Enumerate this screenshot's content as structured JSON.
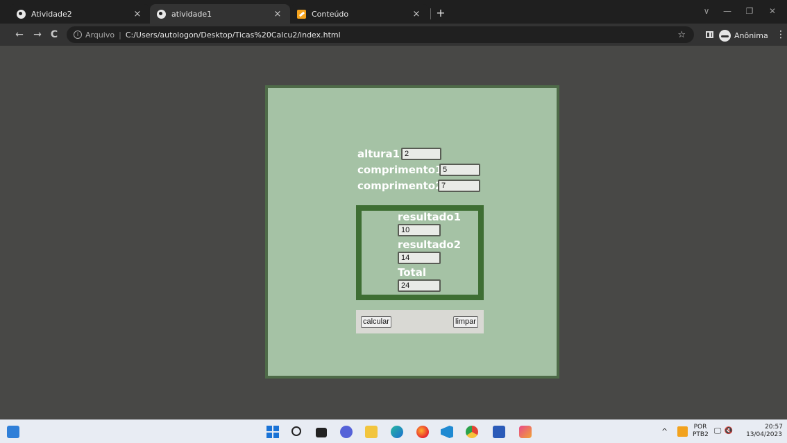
{
  "browser": {
    "tabs": [
      {
        "title": "Atividade2",
        "close": "×"
      },
      {
        "title": "atividade1",
        "close": "×"
      },
      {
        "title": "Conteúdo",
        "close": "×"
      }
    ],
    "new_tab": "+",
    "window_controls": {
      "minimize_left": "∨",
      "minimize": "—",
      "restore": "❐",
      "close": "✕"
    },
    "nav": {
      "back": "←",
      "forward": "→",
      "reload": "C"
    },
    "address": {
      "security_label": "Arquivo",
      "separator": "|",
      "url": "C:/Users/autologon/Desktop/Ticas%20Calcu2/index.html"
    },
    "bookmark_star": "☆",
    "profile_label": "Anônima",
    "menu": "⋮"
  },
  "form": {
    "altura1_label": "altura1:",
    "altura1_value": "2",
    "comprimento1_label": "comprimento1:",
    "comprimento1_value": "5",
    "comprimento2_label": "comprimento2:",
    "comprimento2_value": "7"
  },
  "results": {
    "resultado1_label": "resultado1",
    "resultado1_value": "10",
    "resultado2_label": "resultado2",
    "resultado2_value": "14",
    "total_label": "Total",
    "total_value": "24"
  },
  "buttons": {
    "calcular": "calcular",
    "limpar": "limpar"
  },
  "taskbar": {
    "caret": "^",
    "language": "POR",
    "keyboard": "PTB2",
    "time": "20:57",
    "date": "13/04/2023",
    "sound": "🔇",
    "network": "🖵"
  },
  "colors": {
    "card_bg": "#a5c2a5",
    "card_border": "#4e6b48",
    "result_border": "#3e6e33",
    "page_bg": "#484846"
  }
}
